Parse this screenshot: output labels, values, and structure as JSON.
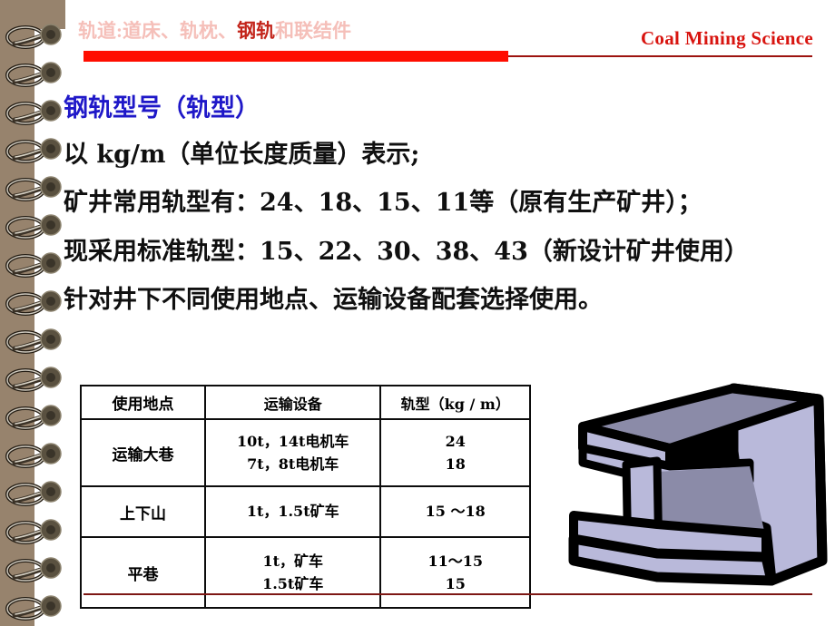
{
  "header": {
    "title_prefix": "轨道:道床、轨枕、",
    "title_strong": "钢轨",
    "title_suffix": "和联结件",
    "course": "Coal Mining Science",
    "accent_bar_color": "#ff0d00",
    "accent_line_color": "#9d130f",
    "title_color": "#f5bfb9",
    "title_strong_color": "#c3251b",
    "course_color": "#d8140f"
  },
  "body": {
    "heading": "钢轨型号（轨型）",
    "heading_color": "#1f18c8",
    "lines": [
      "以 kg/m（单位长度质量）表示;",
      "矿井常用轨型有：24、18、15、11等（原有生产矿井）；",
      "现采用标准轨型：15、22、30、38、43（新设计矿井使用）",
      "针对井下不同使用地点、运输设备配套选择使用。"
    ]
  },
  "table": {
    "headers": [
      "使用地点",
      "运输设备",
      "轨型（kg / m）"
    ],
    "rows": [
      {
        "place": "运输大巷",
        "equipment": [
          "10t，14t电机车",
          "7t，8t电机车"
        ],
        "rail_type": [
          "24",
          "18"
        ]
      },
      {
        "place": "上下山",
        "equipment": [
          "1t，1.5t矿车"
        ],
        "rail_type": [
          "15 ～18"
        ]
      },
      {
        "place": "平巷",
        "equipment": [
          "1t，矿车",
          "1.5t矿车"
        ],
        "rail_type": [
          "11～15",
          "15"
        ]
      }
    ]
  },
  "illustration": {
    "name": "steel-rail-i-beam",
    "face_top_color": "#8b8ba8",
    "face_light_color": "#b9b9da",
    "face_mid_color": "#a0a0c0",
    "outline_color": "#000000"
  },
  "binding": {
    "strip_color": "#97836d",
    "ring_count": 16
  },
  "footer": {
    "rule_color": "#7d1714"
  }
}
